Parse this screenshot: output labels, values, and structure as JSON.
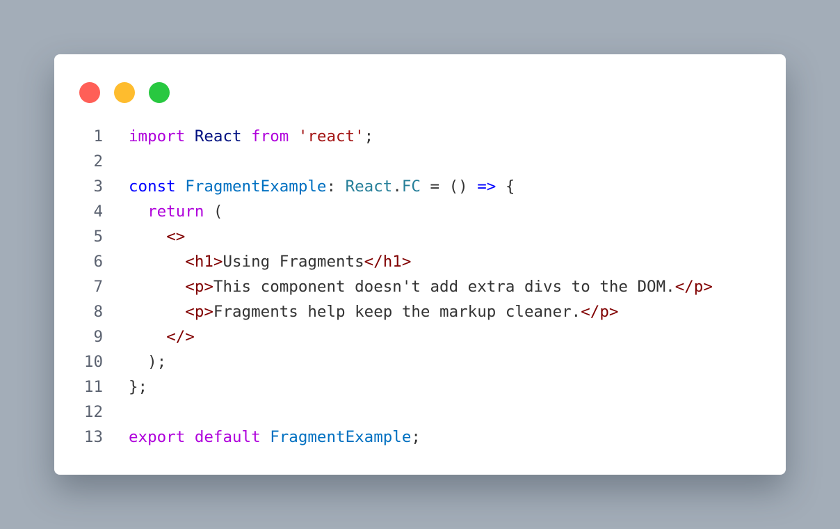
{
  "colors": {
    "background": "#a3adb8",
    "window": "#ffffff",
    "close": "#ff5f57",
    "minimize": "#febc2e",
    "maximize": "#28c840",
    "keyword": "#af00db",
    "storage": "#0000ff",
    "identifier": "#001080",
    "function_name": "#0070c1",
    "type": "#267f99",
    "string": "#a31515",
    "tag": "#800000",
    "text": "#333333",
    "line_number": "#5b6270"
  },
  "window_controls": [
    {
      "name": "close-button",
      "color": "#ff5f57"
    },
    {
      "name": "minimize-button",
      "color": "#febc2e"
    },
    {
      "name": "maximize-button",
      "color": "#28c840"
    }
  ],
  "code": {
    "language": "tsx",
    "lines": [
      {
        "number": "1",
        "tokens": [
          {
            "text": "import",
            "kind": "keyword"
          },
          {
            "text": " ",
            "kind": "text"
          },
          {
            "text": "React",
            "kind": "identifier"
          },
          {
            "text": " ",
            "kind": "text"
          },
          {
            "text": "from",
            "kind": "keyword"
          },
          {
            "text": " ",
            "kind": "text"
          },
          {
            "text": "'react'",
            "kind": "string"
          },
          {
            "text": ";",
            "kind": "text"
          }
        ]
      },
      {
        "number": "2",
        "tokens": []
      },
      {
        "number": "3",
        "tokens": [
          {
            "text": "const",
            "kind": "storage"
          },
          {
            "text": " ",
            "kind": "text"
          },
          {
            "text": "FragmentExample",
            "kind": "function_name"
          },
          {
            "text": ": ",
            "kind": "text"
          },
          {
            "text": "React",
            "kind": "type"
          },
          {
            "text": ".",
            "kind": "text"
          },
          {
            "text": "FC",
            "kind": "type"
          },
          {
            "text": " = () ",
            "kind": "text"
          },
          {
            "text": "=>",
            "kind": "storage"
          },
          {
            "text": " {",
            "kind": "text"
          }
        ]
      },
      {
        "number": "4",
        "tokens": [
          {
            "text": "  ",
            "kind": "text"
          },
          {
            "text": "return",
            "kind": "keyword"
          },
          {
            "text": " (",
            "kind": "text"
          }
        ]
      },
      {
        "number": "5",
        "tokens": [
          {
            "text": "    ",
            "kind": "text"
          },
          {
            "text": "<>",
            "kind": "tag"
          }
        ]
      },
      {
        "number": "6",
        "tokens": [
          {
            "text": "      ",
            "kind": "text"
          },
          {
            "text": "<h1>",
            "kind": "tag"
          },
          {
            "text": "Using Fragments",
            "kind": "text"
          },
          {
            "text": "</h1>",
            "kind": "tag"
          }
        ]
      },
      {
        "number": "7",
        "tokens": [
          {
            "text": "      ",
            "kind": "text"
          },
          {
            "text": "<p>",
            "kind": "tag"
          },
          {
            "text": "This component doesn't add extra divs to the DOM.",
            "kind": "text"
          },
          {
            "text": "</p>",
            "kind": "tag"
          }
        ]
      },
      {
        "number": "8",
        "tokens": [
          {
            "text": "      ",
            "kind": "text"
          },
          {
            "text": "<p>",
            "kind": "tag"
          },
          {
            "text": "Fragments help keep the markup cleaner.",
            "kind": "text"
          },
          {
            "text": "</p>",
            "kind": "tag"
          }
        ]
      },
      {
        "number": "9",
        "tokens": [
          {
            "text": "    ",
            "kind": "text"
          },
          {
            "text": "</>",
            "kind": "tag"
          }
        ]
      },
      {
        "number": "10",
        "tokens": [
          {
            "text": "  );",
            "kind": "text"
          }
        ]
      },
      {
        "number": "11",
        "tokens": [
          {
            "text": "};",
            "kind": "text"
          }
        ]
      },
      {
        "number": "12",
        "tokens": []
      },
      {
        "number": "13",
        "tokens": [
          {
            "text": "export",
            "kind": "keyword"
          },
          {
            "text": " ",
            "kind": "text"
          },
          {
            "text": "default",
            "kind": "keyword"
          },
          {
            "text": " ",
            "kind": "text"
          },
          {
            "text": "FragmentExample",
            "kind": "function_name"
          },
          {
            "text": ";",
            "kind": "text"
          }
        ]
      }
    ]
  }
}
